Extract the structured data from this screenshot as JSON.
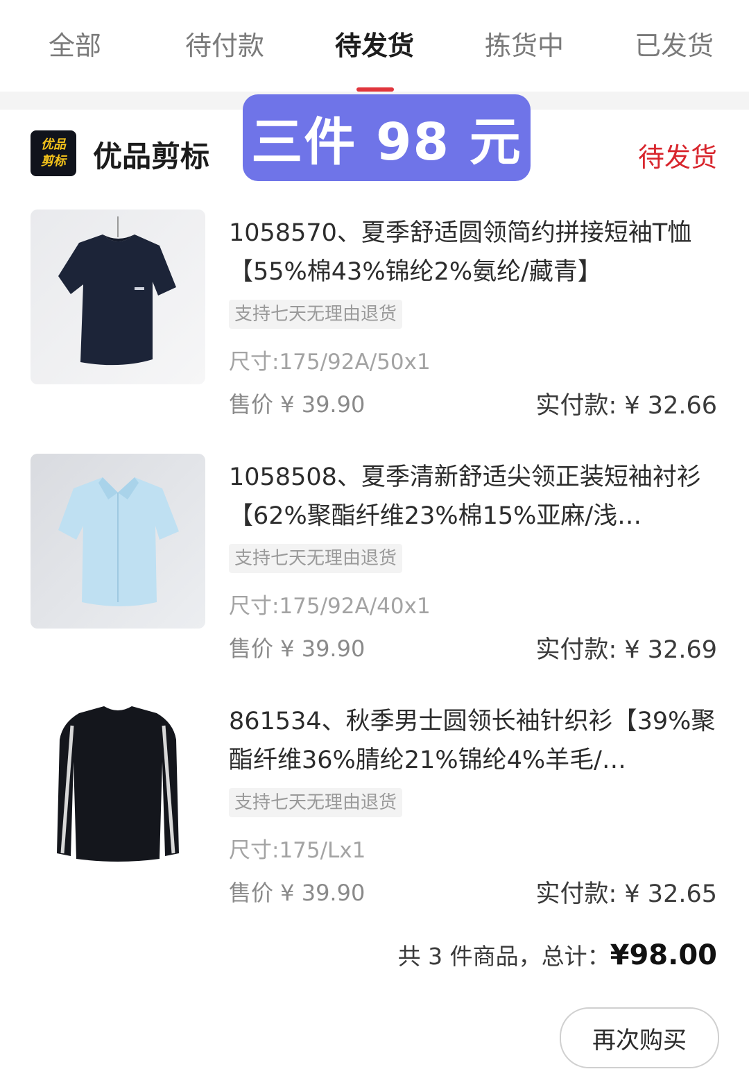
{
  "tabs": [
    {
      "label": "全部"
    },
    {
      "label": "待付款"
    },
    {
      "label": "待发货",
      "active": true
    },
    {
      "label": "拣货中"
    },
    {
      "label": "已发货"
    }
  ],
  "shop": {
    "logo_text_line1": "优品",
    "logo_text_line2": "剪标",
    "name": "优品剪标",
    "status": "待发货"
  },
  "promo_banner": "三件 98 元",
  "items": [
    {
      "title": "1058570、夏季舒适圆领简约拼接短袖T恤【55%棉43%锦纶2%氨纶/藏青】",
      "tag": "支持七天无理由退货",
      "spec": "尺寸:175/92A/50x1",
      "price": "售价 ¥ 39.90",
      "paid": "实付款: ¥ 32.66",
      "image": "navy-tshirt"
    },
    {
      "title": "1058508、夏季清新舒适尖领正装短袖衬衫【62%聚酯纤维23%棉15%亚麻/浅…",
      "tag": "支持七天无理由退货",
      "spec": "尺寸:175/92A/40x1",
      "price": "售价 ¥ 39.90",
      "paid": "实付款: ¥ 32.69",
      "image": "light-blue-shirt"
    },
    {
      "title": "861534、秋季男士圆领长袖针织衫【39%聚酯纤维36%腈纶21%锦纶4%羊毛/…",
      "tag": "支持七天无理由退货",
      "spec": "尺寸:175/Lx1",
      "price": "售价 ¥ 39.90",
      "paid": "实付款: ¥ 32.65",
      "image": "black-sweater"
    }
  ],
  "summary": {
    "count_text": "共 3 件商品，总计：",
    "total": "¥98.00"
  },
  "rebuy_button": "再次购买",
  "colors": {
    "accent_red": "#d8262d",
    "promo_purple": "#6f74e8"
  }
}
